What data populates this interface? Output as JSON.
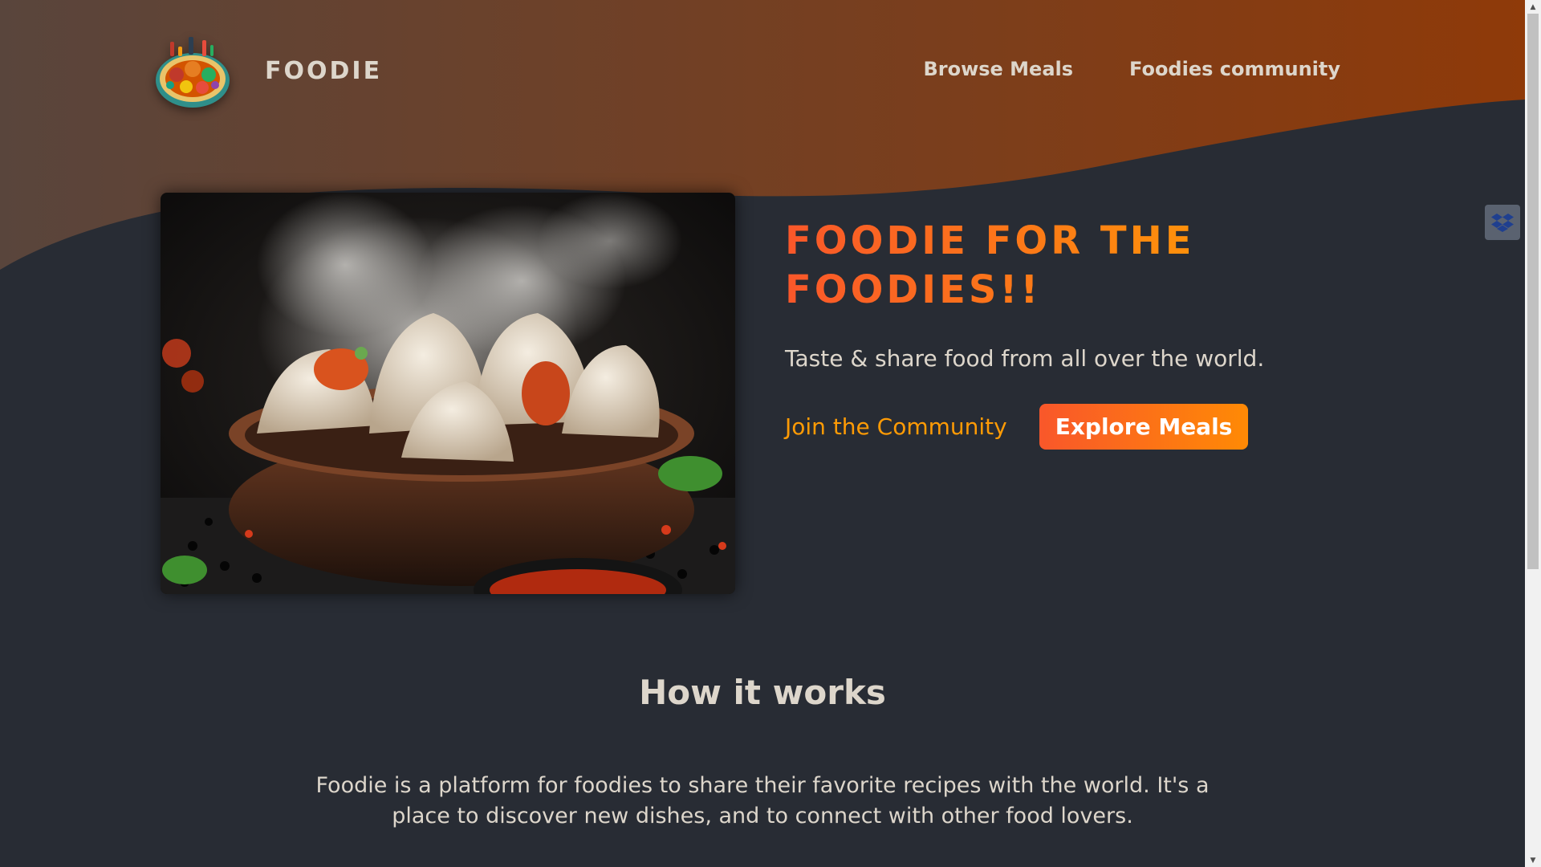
{
  "header": {
    "logo_alt": "A plate with food on it",
    "logo_text": "FOODIE",
    "nav": [
      {
        "label": "Browse Meals"
      },
      {
        "label": "Foodies community"
      }
    ]
  },
  "hero": {
    "image_alt": "Steaming dumplings in a bowl",
    "title": "Foodie for the foodies!!",
    "subtitle": "Taste & share food from all over the world.",
    "join_label": "Join the Community",
    "explore_label": "Explore Meals"
  },
  "how_it_works": {
    "title": "How it works",
    "text": "Foodie is a platform for foodies to share their favorite recipes with the world. It's a place to discover new dishes, and to connect with other food lovers."
  },
  "widgets": {
    "dropbox_icon": "dropbox-icon"
  },
  "colors": {
    "background": "#282c34",
    "text": "#ddd6cb",
    "accent_start": "#f9572a",
    "accent_end": "#ff9b05",
    "header_left": "#59453c",
    "header_right": "#8f3a09"
  }
}
